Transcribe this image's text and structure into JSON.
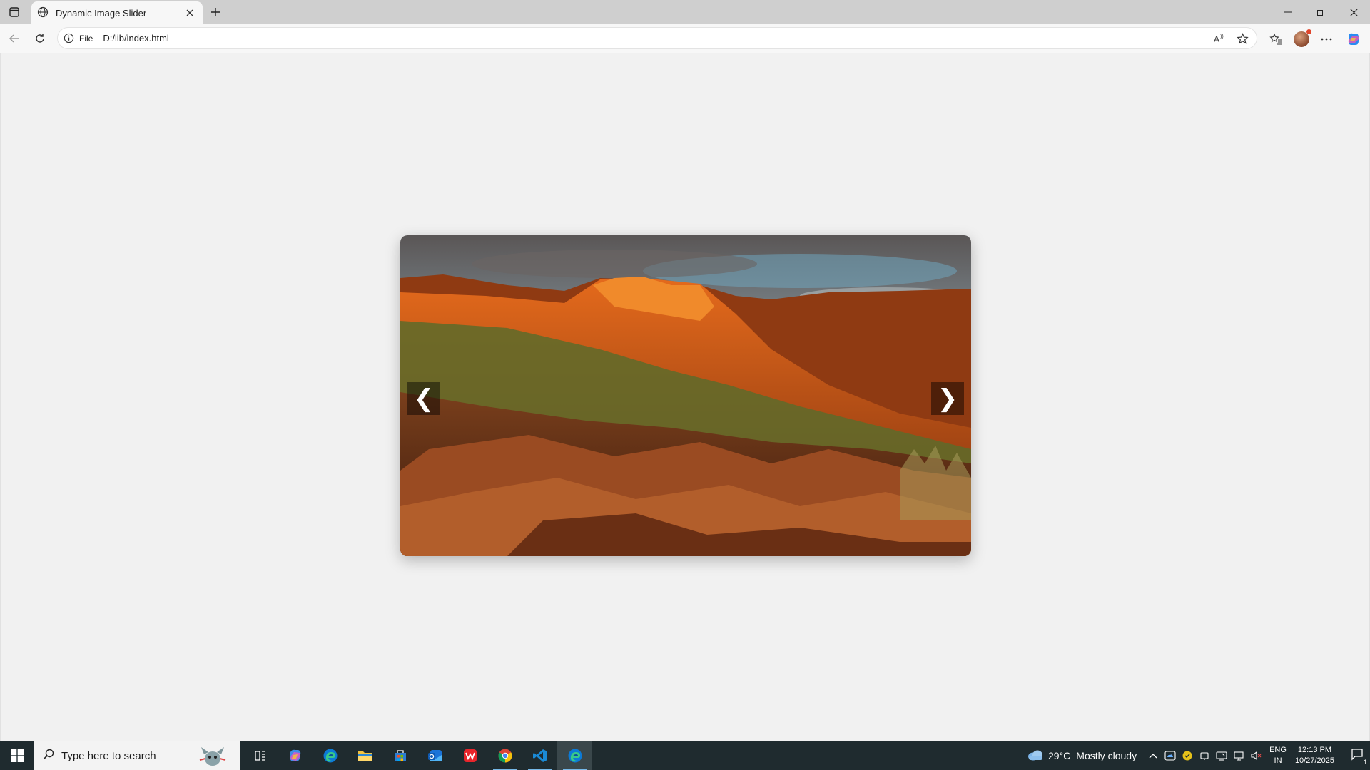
{
  "browser": {
    "tab_title": "Dynamic Image Slider",
    "address_scheme": "File",
    "address_url": "D:/lib/index.html",
    "accent_color": "#0078d4"
  },
  "slider": {
    "prev_symbol": "❮",
    "next_symbol": "❯",
    "image_description_icon": "landscape-photo"
  },
  "taskbar": {
    "search_placeholder": "Type here to search",
    "pinned_apps": [
      "task-view",
      "copilot",
      "edge",
      "file-explorer",
      "microsoft-store",
      "outlook",
      "wps-office",
      "chrome",
      "vscode",
      "edge-active"
    ],
    "weather_temp": "29°C",
    "weather_condition": "Mostly cloudy",
    "language_line1": "ENG",
    "language_line2": "IN",
    "time": "12:13 PM",
    "date": "10/27/2025",
    "notification_count": "1"
  }
}
